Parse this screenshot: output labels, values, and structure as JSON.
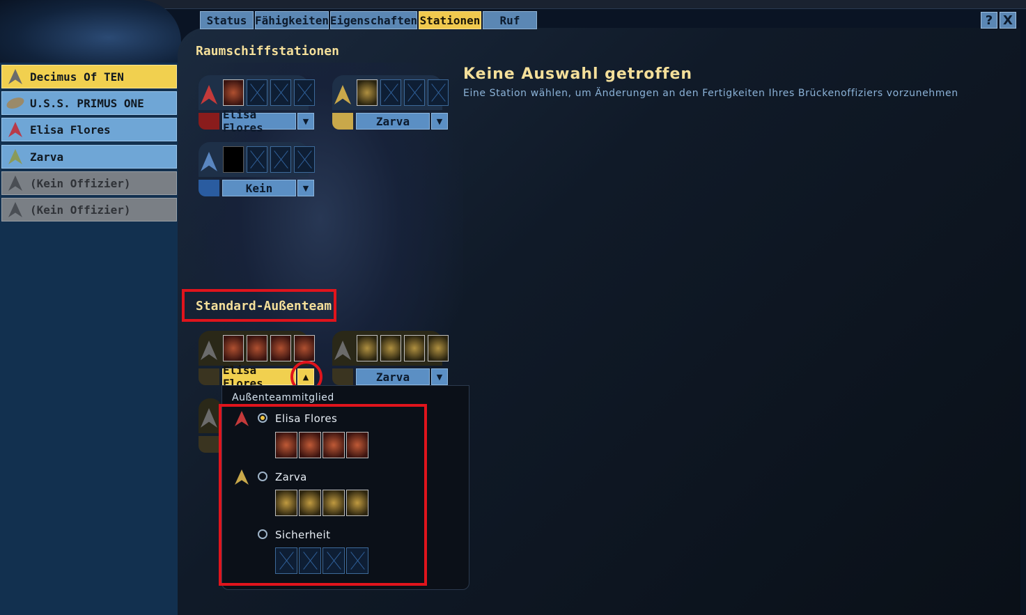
{
  "tabs": [
    "Status",
    "Fähigkeiten",
    "Eigenschaften",
    "Stationen",
    "Ruf"
  ],
  "active_tab": "Stationen",
  "window": {
    "help_label": "?",
    "close_label": "X"
  },
  "roster": [
    {
      "label": "Decimus Of TEN",
      "state": "selected"
    },
    {
      "label": "U.S.S. PRIMUS ONE",
      "state": "normal"
    },
    {
      "label": "Elisa Flores",
      "state": "normal"
    },
    {
      "label": "Zarva",
      "state": "normal"
    },
    {
      "label": "(Kein Offizier)",
      "state": "empty"
    },
    {
      "label": "(Kein Offizier)",
      "state": "empty"
    }
  ],
  "ship_section": {
    "title": "Raumschiffstationen",
    "stations": [
      {
        "officer": "Elisa Flores",
        "color": "#8a1c1c",
        "rank_color": "#c43a3a"
      },
      {
        "officer": "Zarva",
        "color": "#c9a84a",
        "rank_color": "#c9a84a"
      },
      {
        "officer": "Kein",
        "color": "#2a5ca0",
        "rank_color": "#5a86c0"
      }
    ]
  },
  "info": {
    "title": "Keine Auswahl getroffen",
    "description": "Eine Station wählen, um Änderungen an den Fertigkeiten Ihres Brückenoffiziers vorzunehmen"
  },
  "away_section": {
    "title": "Standard-Außenteam",
    "slots": [
      {
        "officer": "Elisa Flores"
      },
      {
        "officer": "Zarva"
      }
    ]
  },
  "popup": {
    "header": "Außenteammitglied",
    "options": [
      {
        "name": "Elisa Flores",
        "selected": true
      },
      {
        "name": "Zarva",
        "selected": false
      },
      {
        "name": "Sicherheit",
        "selected": false
      }
    ]
  },
  "colors": {
    "accent_gold": "#f1d04f",
    "accent_blue": "#5b8fc4",
    "highlight_red": "#e0141c"
  }
}
